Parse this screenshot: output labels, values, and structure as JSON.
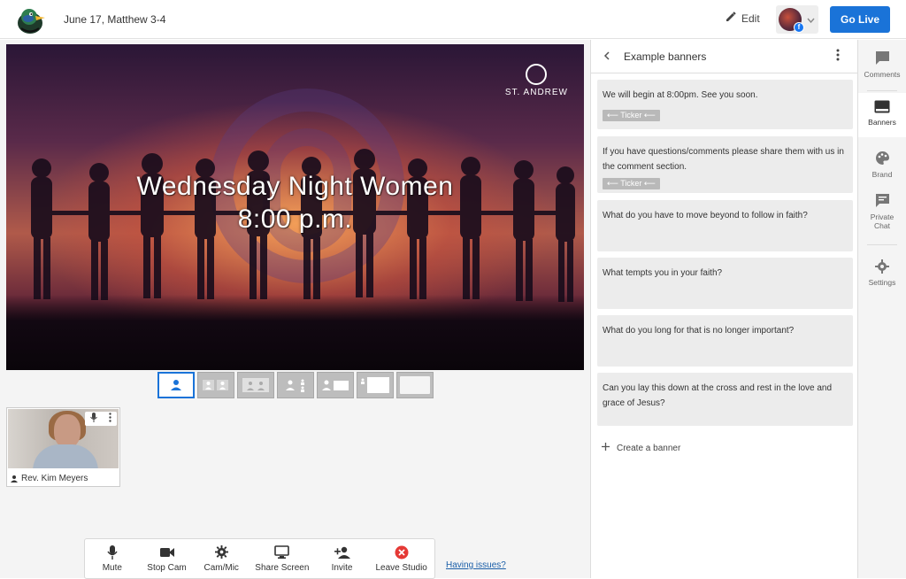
{
  "header": {
    "title": "June 17, Matthew 3-4",
    "edit_label": "Edit",
    "go_live_label": "Go Live"
  },
  "stage": {
    "brand": "ST. ANDREW",
    "headline_line1": "Wednesday Night Women",
    "headline_line2": "8:00 p.m."
  },
  "participant": {
    "name": "Rev. Kim Meyers"
  },
  "controls": [
    {
      "label": "Mute",
      "icon": "microphone-icon"
    },
    {
      "label": "Stop Cam",
      "icon": "video-camera-icon"
    },
    {
      "label": "Cam/Mic",
      "icon": "gear-icon"
    },
    {
      "label": "Share Screen",
      "icon": "monitor-icon"
    },
    {
      "label": "Invite",
      "icon": "add-person-icon"
    },
    {
      "label": "Leave Studio",
      "icon": "close-circle-icon"
    }
  ],
  "issues_link": "Having issues?",
  "panel": {
    "title": "Example banners",
    "banners": [
      {
        "text": "We will begin at 8:00pm. See you soon.",
        "ticker": "⟵ Ticker ⟵"
      },
      {
        "text": "If you have questions/comments please share them with us in the comment section.",
        "ticker": "⟵ Ticker ⟵"
      },
      {
        "text": "What do you have to move beyond to follow in faith?"
      },
      {
        "text": "What tempts you in your faith?"
      },
      {
        "text": "What do you long for that is no longer important?"
      },
      {
        "text": "Can you lay this down at the cross and rest in the love and grace of Jesus?"
      }
    ],
    "create_label": "Create a banner"
  },
  "rail": [
    {
      "label": "Comments",
      "icon": "comment-icon"
    },
    {
      "label": "Banners",
      "icon": "banner-icon"
    },
    {
      "label": "Brand",
      "icon": "palette-icon"
    },
    {
      "label": "Private Chat",
      "icon": "chat-icon"
    },
    {
      "label": "Settings",
      "icon": "gear-icon"
    }
  ],
  "colors": {
    "primary": "#1a73d8",
    "leave": "#e53935",
    "banner_bg": "#ececec"
  }
}
